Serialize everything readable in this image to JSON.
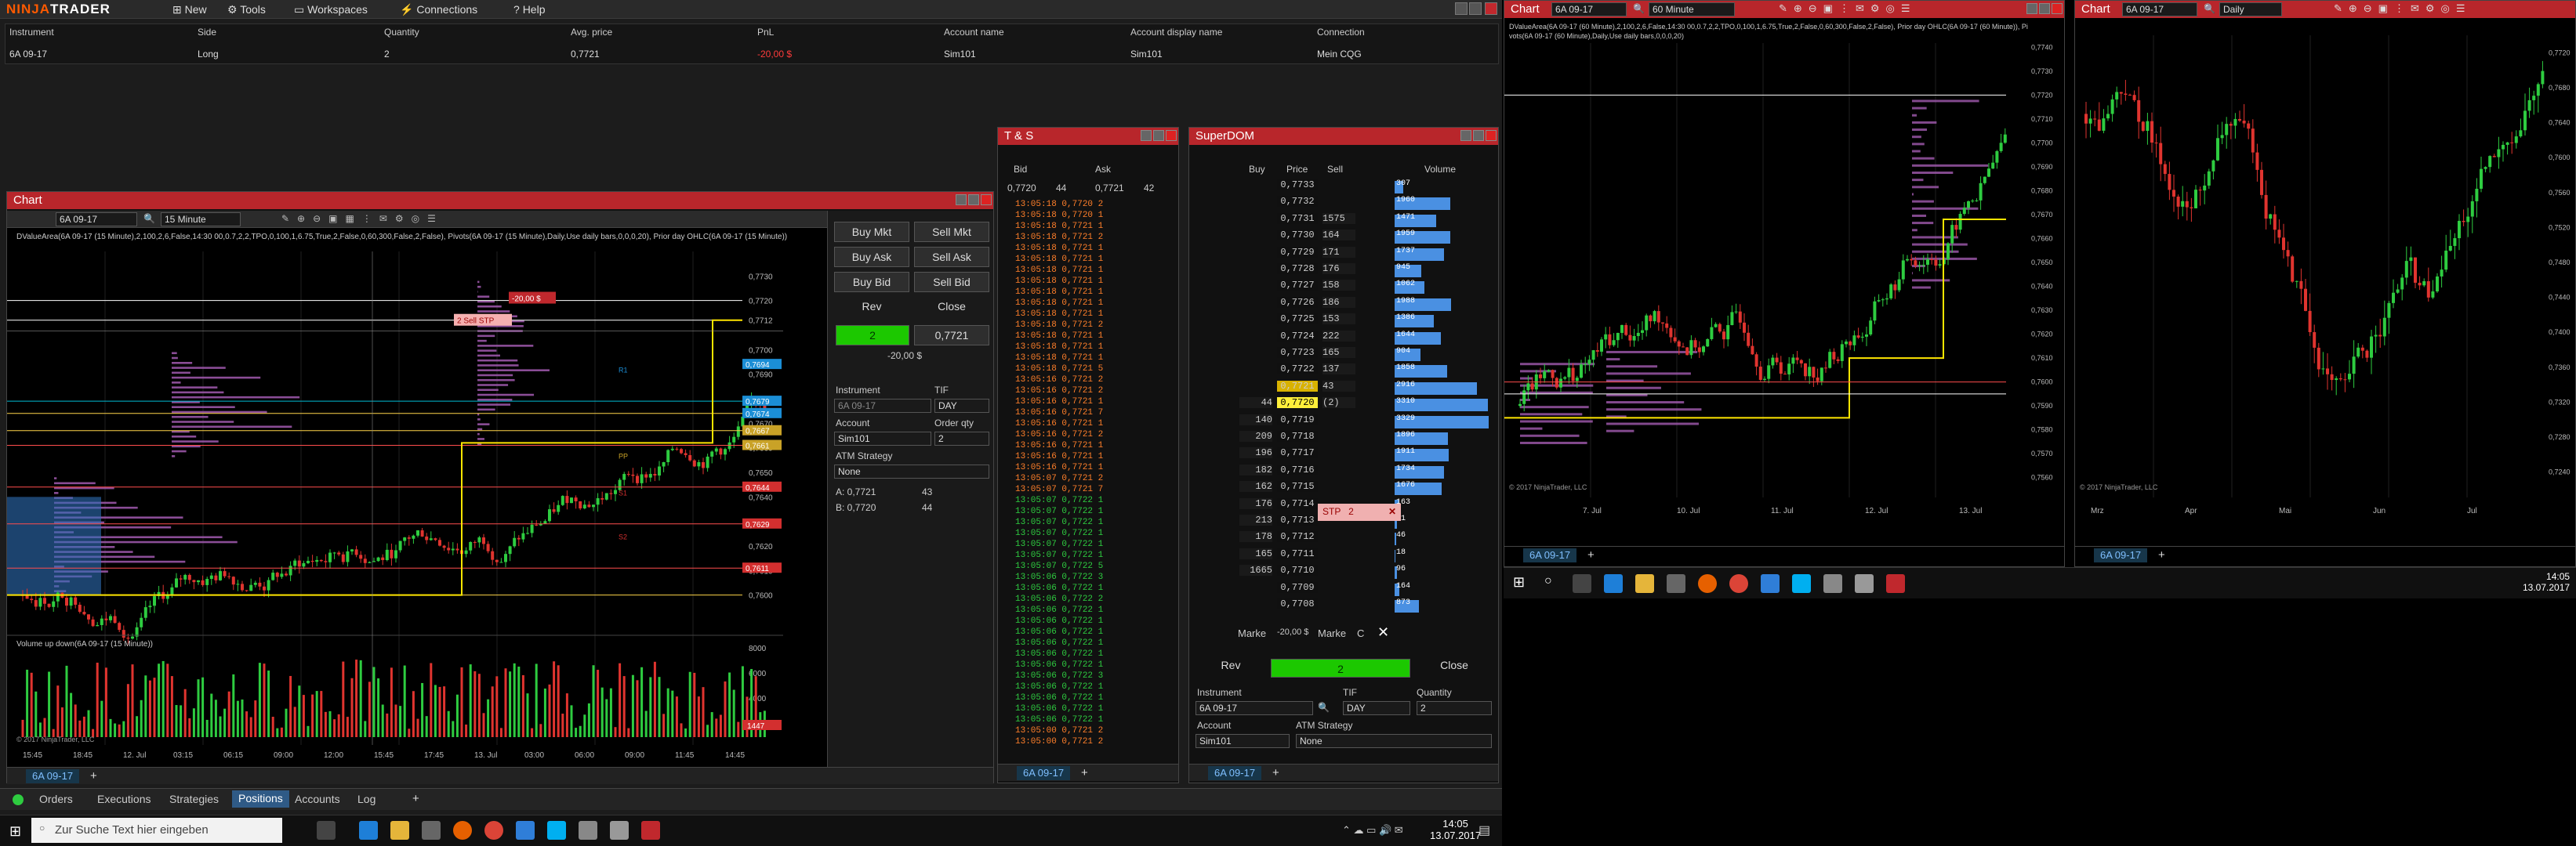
{
  "app": {
    "name": "NinjaTrader",
    "logo_a": "NINJA",
    "logo_b": "TRADER",
    "menu": [
      {
        "label": "New",
        "icon": "doc-icon"
      },
      {
        "label": "Tools",
        "icon": "gear-icon"
      },
      {
        "label": "Workspaces",
        "icon": "folder-icon"
      },
      {
        "label": "Connections",
        "icon": "plug-icon"
      },
      {
        "label": "Help",
        "icon": "help-icon"
      }
    ]
  },
  "positions": {
    "headers": [
      "Instrument",
      "Side",
      "Quantity",
      "Avg. price",
      "PnL",
      "Account name",
      "Account display name",
      "Connection"
    ],
    "row": [
      "6A 09-17",
      "Long",
      "2",
      "0,7721",
      "-20,00 $",
      "Sim101",
      "Sim101",
      "Mein CQG"
    ]
  },
  "chart1": {
    "title": "Chart",
    "instrument": "6A 09-17",
    "interval": "15 Minute",
    "indicator_text": "DValueArea(6A 09-17 (15 Minute),2,100,2,6,False,14:30 00,0.7,2,2,TPO,0,100,1,6.75,True,2,False,0,60,300,False,2,False), Pivots(6A 09-17 (15 Minute),Daily,Use daily bars,0,0,0,20), Prior day OHLC(6A 09-17 (15 Minute))",
    "price_labels": [
      "0,7730",
      "0,7720",
      "0,7712",
      "0,7700",
      "0,7690",
      "0,7680",
      "0,7670",
      "0,7660",
      "0,7650",
      "0,7640",
      "0,7630",
      "0,7620",
      "0,7610",
      "0,7600"
    ],
    "marker_labels": [
      "0,7694",
      "0,7679",
      "0,7674",
      "0,7667",
      "0,7661",
      "0,7644",
      "0,7629",
      "0,7611"
    ],
    "order_label": "-20,00 $",
    "order_qty": "2",
    "sell_stp": "2 Sell STP",
    "pivot_labels": [
      "R1",
      "PP",
      "S1",
      "S2"
    ],
    "volume_title": "Volume up down(6A 09-17 (15 Minute))",
    "volume_axis": [
      "8000",
      "6000",
      "4000",
      "2000"
    ],
    "volume_value": "1447",
    "copyright": "© 2017 NinjaTrader, LLC",
    "time_labels": [
      "15:45",
      "18:45",
      "12. Jul",
      "03:15",
      "06:15",
      "09:00",
      "12:00",
      "15:45",
      "17:45",
      "13. Jul",
      "03:00",
      "06:00",
      "09:00",
      "11:45",
      "14:45"
    ],
    "tab": "6A 09-17"
  },
  "order_entry": {
    "buy_mkt": "Buy Mkt",
    "sell_mkt": "Sell Mkt",
    "buy_ask": "Buy Ask",
    "sell_ask": "Sell Ask",
    "buy_bid": "Buy Bid",
    "sell_bid": "Sell Bid",
    "rev": "Rev",
    "close": "Close",
    "qty": "2",
    "price": "0,7721",
    "pnl": "-20,00 $",
    "instrument_label": "Instrument",
    "instrument": "6A 09-17",
    "tif_label": "TIF",
    "tif": "DAY",
    "account_label": "Account",
    "account": "Sim101",
    "order_qty_label": "Order qty",
    "order_qty": "2",
    "atm_label": "ATM Strategy",
    "atm": "None",
    "ask_line": "A:  0,7721",
    "ask_size": "43",
    "bid_line": "B:  0,7720",
    "bid_size": "44"
  },
  "ts": {
    "title": "T & S",
    "headers": [
      "Bid",
      "Ask"
    ],
    "bid": "0,7720",
    "bid_size": "44",
    "ask": "0,7721",
    "ask_size": "42",
    "tab": "6A 09-17",
    "rows": [
      [
        "13:05:18",
        "0,7720",
        "2",
        "r"
      ],
      [
        "13:05:18",
        "0,7720",
        "1",
        "r"
      ],
      [
        "13:05:18",
        "0,7721",
        "1",
        "r"
      ],
      [
        "13:05:18",
        "0,7721",
        "2",
        "r"
      ],
      [
        "13:05:18",
        "0,7721",
        "1",
        "r"
      ],
      [
        "13:05:18",
        "0,7721",
        "1",
        "r"
      ],
      [
        "13:05:18",
        "0,7721",
        "1",
        "r"
      ],
      [
        "13:05:18",
        "0,7721",
        "1",
        "r"
      ],
      [
        "13:05:18",
        "0,7721",
        "1",
        "r"
      ],
      [
        "13:05:18",
        "0,7721",
        "1",
        "r"
      ],
      [
        "13:05:18",
        "0,7721",
        "1",
        "r"
      ],
      [
        "13:05:18",
        "0,7721",
        "2",
        "r"
      ],
      [
        "13:05:18",
        "0,7721",
        "1",
        "r"
      ],
      [
        "13:05:18",
        "0,7721",
        "1",
        "r"
      ],
      [
        "13:05:18",
        "0,7721",
        "1",
        "r"
      ],
      [
        "13:05:18",
        "0,7721",
        "5",
        "r"
      ],
      [
        "13:05:16",
        "0,7721",
        "2",
        "r"
      ],
      [
        "13:05:16",
        "0,7721",
        "2",
        "r"
      ],
      [
        "13:05:16",
        "0,7721",
        "1",
        "r"
      ],
      [
        "13:05:16",
        "0,7721",
        "7",
        "r"
      ],
      [
        "13:05:16",
        "0,7721",
        "1",
        "r"
      ],
      [
        "13:05:16",
        "0,7721",
        "2",
        "r"
      ],
      [
        "13:05:16",
        "0,7721",
        "1",
        "r"
      ],
      [
        "13:05:16",
        "0,7721",
        "1",
        "r"
      ],
      [
        "13:05:16",
        "0,7721",
        "1",
        "r"
      ],
      [
        "13:05:07",
        "0,7721",
        "2",
        "r"
      ],
      [
        "13:05:07",
        "0,7721",
        "7",
        "r"
      ],
      [
        "13:05:07",
        "0,7722",
        "1",
        "g"
      ],
      [
        "13:05:07",
        "0,7722",
        "1",
        "g"
      ],
      [
        "13:05:07",
        "0,7722",
        "1",
        "g"
      ],
      [
        "13:05:07",
        "0,7722",
        "1",
        "g"
      ],
      [
        "13:05:07",
        "0,7722",
        "1",
        "g"
      ],
      [
        "13:05:07",
        "0,7722",
        "1",
        "g"
      ],
      [
        "13:05:07",
        "0,7722",
        "5",
        "g"
      ],
      [
        "13:05:06",
        "0,7722",
        "3",
        "g"
      ],
      [
        "13:05:06",
        "0,7722",
        "1",
        "g"
      ],
      [
        "13:05:06",
        "0,7722",
        "2",
        "g"
      ],
      [
        "13:05:06",
        "0,7722",
        "1",
        "g"
      ],
      [
        "13:05:06",
        "0,7722",
        "1",
        "g"
      ],
      [
        "13:05:06",
        "0,7722",
        "1",
        "g"
      ],
      [
        "13:05:06",
        "0,7722",
        "1",
        "g"
      ],
      [
        "13:05:06",
        "0,7722",
        "1",
        "g"
      ],
      [
        "13:05:06",
        "0,7722",
        "1",
        "g"
      ],
      [
        "13:05:06",
        "0,7722",
        "3",
        "g"
      ],
      [
        "13:05:06",
        "0,7722",
        "1",
        "g"
      ],
      [
        "13:05:06",
        "0,7722",
        "1",
        "g"
      ],
      [
        "13:05:06",
        "0,7722",
        "1",
        "g"
      ],
      [
        "13:05:06",
        "0,7722",
        "1",
        "g"
      ],
      [
        "13:05:00",
        "0,7721",
        "2",
        "r"
      ],
      [
        "13:05:00",
        "0,7721",
        "2",
        "r"
      ]
    ]
  },
  "dom": {
    "title": "SuperDOM",
    "headers": [
      "Buy",
      "Price",
      "Sell",
      "Volume"
    ],
    "rows": [
      [
        "",
        "0,7733",
        "",
        "307"
      ],
      [
        "",
        "0,7732",
        "",
        "1960"
      ],
      [
        "",
        "0,7731",
        "1575",
        "1471"
      ],
      [
        "",
        "0,7730",
        "164",
        "1959"
      ],
      [
        "",
        "0,7729",
        "171",
        "1737"
      ],
      [
        "",
        "0,7728",
        "176",
        "945"
      ],
      [
        "",
        "0,7727",
        "158",
        "1062"
      ],
      [
        "",
        "0,7726",
        "186",
        "1988"
      ],
      [
        "",
        "0,7725",
        "153",
        "1386"
      ],
      [
        "",
        "0,7724",
        "222",
        "1644"
      ],
      [
        "",
        "0,7723",
        "165",
        "904"
      ],
      [
        "",
        "0,7722",
        "137",
        "1858"
      ],
      [
        "",
        "0,7721",
        "43",
        "2916"
      ],
      [
        "44",
        "0,7720",
        "(2)",
        "3310"
      ],
      [
        "140",
        "0,7719",
        "",
        "3329"
      ],
      [
        "209",
        "0,7718",
        "",
        "1896"
      ],
      [
        "196",
        "0,7717",
        "",
        "1911"
      ],
      [
        "182",
        "0,7716",
        "",
        "1734"
      ],
      [
        "162",
        "0,7715",
        "",
        "1676"
      ],
      [
        "176",
        "0,7714",
        "",
        "163"
      ],
      [
        "213",
        "0,7713",
        "",
        "81"
      ],
      [
        "178",
        "0,7712",
        "",
        "46"
      ],
      [
        "165",
        "0,7711",
        "",
        "18"
      ],
      [
        "1665",
        "0,7710",
        "",
        "96"
      ],
      [
        "",
        "0,7709",
        "",
        "164"
      ],
      [
        "",
        "0,7708",
        "",
        "873"
      ]
    ],
    "volumes": [
      307,
      1960,
      1471,
      1959,
      1737,
      945,
      1062,
      1988,
      1386,
      1644,
      904,
      1858,
      2916,
      3310,
      3329,
      1896,
      1911,
      1734,
      1676,
      163,
      81,
      46,
      18,
      96,
      164,
      873
    ],
    "stp_label": "STP",
    "stp_qty": "2",
    "market_left": "Marke",
    "pnl": "-20,00 $",
    "market_right": "Marke",
    "c_label": "C",
    "rev": "Rev",
    "qty": "2",
    "close": "Close",
    "instrument_label": "Instrument",
    "instrument": "6A 09-17",
    "tif_label": "TIF",
    "tif": "DAY",
    "quantity_label": "Quantity",
    "quantity": "2",
    "account_label": "Account",
    "account": "Sim101",
    "atm_label": "ATM Strategy",
    "atm": "None",
    "tab": "6A 09-17"
  },
  "chart2": {
    "title": "Chart",
    "instrument": "6A 09-17",
    "interval": "60 Minute",
    "indicator_text": "DValueArea(6A 09-17 (60 Minute),2,100,2,6,False,14:30 00,0.7,2,2,TPO,0,100,1,6.75,True,2,False,0,60,300,False,2,False), Prior day OHLC(6A 09-17 (60 Minute)), Pivots(6A 09-17 (60 Minute),Daily,Use daily bars,0,0,0,20)",
    "price_labels": [
      "0,7740",
      "0,7730",
      "0,7720",
      "0,7710",
      "0,7700",
      "0,7690",
      "0,7680",
      "0,7670",
      "0,7660",
      "0,7650",
      "0,7640",
      "0,7630",
      "0,7620",
      "0,7610",
      "0,7600",
      "0,7590",
      "0,7580",
      "0,7570",
      "0,7560"
    ],
    "time_labels": [
      "7. Jul",
      "10. Jul",
      "11. Jul",
      "12. Jul",
      "13. Jul"
    ],
    "copyright": "© 2017 NinjaTrader, LLC",
    "tab": "6A 09-17"
  },
  "chart3": {
    "title": "Chart",
    "instrument": "6A 09-17",
    "interval": "Daily",
    "price_labels": [
      "0,7720",
      "0,7680",
      "0,7640",
      "0,7600",
      "0,7560",
      "0,7520",
      "0,7480",
      "0,7440",
      "0,7400",
      "0,7360",
      "0,7320",
      "0,7280",
      "0,7240"
    ],
    "time_labels": [
      "Mrz",
      "Apr",
      "Mai",
      "Jun",
      "Jul"
    ],
    "copyright": "© 2017 NinjaTrader, LLC",
    "tab": "6A 09-17"
  },
  "bottom_tabs": [
    "Orders",
    "Executions",
    "Strategies",
    "Positions",
    "Accounts",
    "Log"
  ],
  "taskbar": {
    "search_placeholder": "Zur Suche Text hier eingeben",
    "time": "14:05",
    "date": "13.07.2017"
  }
}
